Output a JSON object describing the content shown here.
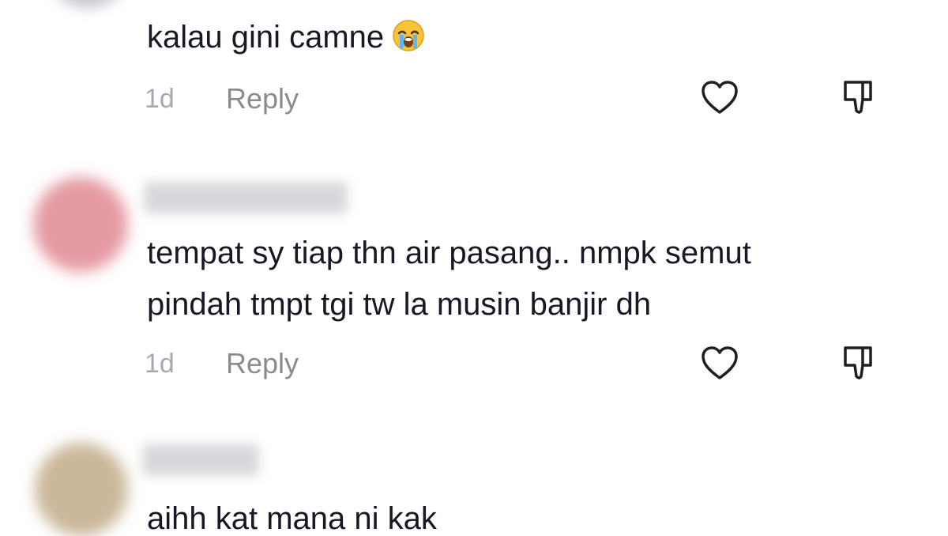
{
  "comments": [
    {
      "lines": [
        "kalau gini camne"
      ],
      "emoji": "loudly-crying-face",
      "time": "1d",
      "reply_label": "Reply"
    },
    {
      "lines": [
        "tempat sy tiap thn air pasang.. nmpk semut",
        "pindah tmpt tgi tw la musin banjir dh"
      ],
      "time": "1d",
      "reply_label": "Reply",
      "avatar_color": "#e59aa3"
    },
    {
      "lines": [
        "aihh kat mana ni kak"
      ],
      "avatar_color": "#cbb79a"
    }
  ],
  "colors": {
    "text": "#161823",
    "muted": "#8a8b91",
    "time": "#a7a9b0",
    "icon": "#1f1f23"
  }
}
